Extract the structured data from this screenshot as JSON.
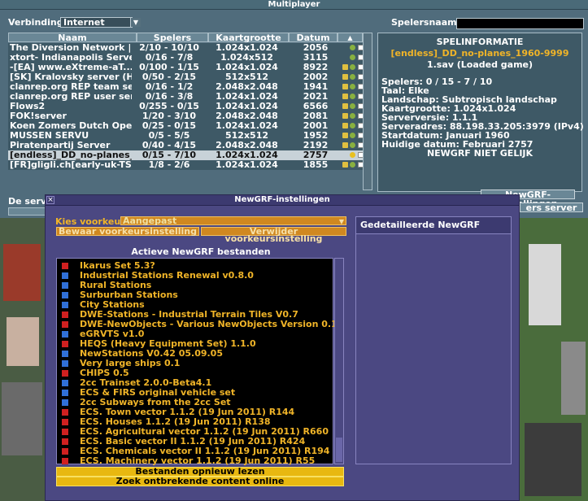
{
  "multiplayer": {
    "title": "Multiplayer",
    "connection_label": "Verbinding:",
    "connection_value": "Internet",
    "player_name_label": "Spelersnaam:",
    "columns": [
      "Naam",
      "Spelers",
      "Kaartgrootte",
      "Datum"
    ],
    "servers": [
      {
        "name": "The Diversion Network | O...",
        "players": "2/10 - 10/10",
        "map": "1.024x1.024",
        "date": "2056",
        "lock": false,
        "status": "green"
      },
      {
        "name": "xtort- Indianapolis Server ...",
        "players": "0/16 - 7/8",
        "map": "1.024x512",
        "date": "3115",
        "lock": false,
        "status": "green"
      },
      {
        "name": "-[EA] www.eXtreme-aT...",
        "players": "0/100 - 1/15",
        "map": "1.024x1.024",
        "date": "8922",
        "lock": true,
        "status": "green"
      },
      {
        "name": "[SK] Kralovsky server (Ha...",
        "players": "0/50 - 2/15",
        "map": "512x512",
        "date": "2002",
        "lock": true,
        "status": "green"
      },
      {
        "name": "clanrep.org REP team server",
        "players": "0/16 - 1/2",
        "map": "2.048x2.048",
        "date": "1941",
        "lock": true,
        "status": "green"
      },
      {
        "name": "clanrep.org REP user server",
        "players": "0/16 - 3/8",
        "map": "1.024x1.024",
        "date": "2021",
        "lock": true,
        "status": "green"
      },
      {
        "name": "Flows2",
        "players": "0/255 - 0/15",
        "map": "1.024x1.024",
        "date": "6566",
        "lock": true,
        "status": "green"
      },
      {
        "name": "FOK!server",
        "players": "1/20 - 3/10",
        "map": "2.048x2.048",
        "date": "2081",
        "lock": true,
        "status": "green"
      },
      {
        "name": "Koen Zomers Dutch OpenT...",
        "players": "0/25 - 0/15",
        "map": "1.024x1.024",
        "date": "2001",
        "lock": true,
        "status": "green"
      },
      {
        "name": "MUSSEN SERVU",
        "players": "0/5 - 5/5",
        "map": "512x512",
        "date": "1952",
        "lock": true,
        "status": "green"
      },
      {
        "name": "Piratenpartij Server",
        "players": "0/40 - 4/15",
        "map": "2.048x2.048",
        "date": "2192",
        "lock": true,
        "status": "green"
      },
      {
        "name": "[endless]_DD_no-planes_...",
        "players": "0/15 - 7/10",
        "map": "1.024x1.024",
        "date": "2757",
        "lock": false,
        "status": "yellow",
        "selected": true
      },
      {
        "name": "[FR]gligli.ch[early-uk-TS]...",
        "players": "1/8 - 2/6",
        "map": "1.024x1.024",
        "date": "1855",
        "lock": true,
        "status": "green"
      }
    ],
    "info": {
      "header": "SPELINFORMATIE",
      "server_name": "[endless]_DD_no-planes_1960-9999",
      "save_name": "1.sav (Loaded game)",
      "lines": [
        "Spelers: 0 / 15 - 7 / 10",
        "Taal: Elke",
        "Landschap: Subtropisch landschap",
        "Kaartgrootte: 1.024x1.024",
        "Serverversie: 1.1.1",
        "Serveradres: 88.198.33.205:3979 (IPv4)",
        "Startdatum: Januari 1960",
        "Huidige datum: Februari 2757"
      ],
      "newgrf_mismatch": "NEWGRF NIET GELIJK"
    },
    "newgrf_settings_button": "NewGRF-instellingen",
    "add_server_button": "ers server",
    "server_label": "De server"
  },
  "newgrf": {
    "title": "NewGRF-instellingen",
    "close_glyph": "×",
    "preset_label": "Kies voorkeur:",
    "preset_value": "Aangepast",
    "save_preset_button": "Bewaar voorkeursinstelling",
    "delete_preset_button": "Verwijder voorkeursinstelling",
    "active_header": "Actieve NewGRF bestanden",
    "files": [
      {
        "name": "Ikarus Set 5.3?",
        "icon": "red"
      },
      {
        "name": "Industrial Stations Renewal v0.8.0",
        "icon": "blue"
      },
      {
        "name": "Rural Stations",
        "icon": "blue"
      },
      {
        "name": "Surburban Stations",
        "icon": "blue"
      },
      {
        "name": "City Stations",
        "icon": "blue"
      },
      {
        "name": "DWE-Stations - Industrial Terrain Tiles V0.7",
        "icon": "red"
      },
      {
        "name": "DWE-NewObjects - Various NewObjects Version 0.1",
        "icon": "red"
      },
      {
        "name": "eGRVTS v1.0",
        "icon": "blue"
      },
      {
        "name": "HEQS (Heavy Equipment Set) 1.1.0",
        "icon": "red"
      },
      {
        "name": "NewStations V0.42 05.09.05",
        "icon": "blue"
      },
      {
        "name": "Very large ships 0.1",
        "icon": "blue"
      },
      {
        "name": "CHIPS 0.5",
        "icon": "red"
      },
      {
        "name": "2cc Trainset 2.0.0-Beta4.1",
        "icon": "blue"
      },
      {
        "name": "ECS & FIRS original vehicle set",
        "icon": "blue"
      },
      {
        "name": "2cc Subways from the 2cc Set",
        "icon": "blue"
      },
      {
        "name": "ECS. Town vector 1.1.2 (19 Jun 2011) R144",
        "icon": "red"
      },
      {
        "name": "ECS. Houses 1.1.2 (19 Jun 2011) R138",
        "icon": "red"
      },
      {
        "name": "ECS. Agricultural vector 1.1.2 (19 Jun 2011) R660",
        "icon": "red"
      },
      {
        "name": "ECS. Basic vector II 1.1.2 (19 Jun 2011) R424",
        "icon": "red"
      },
      {
        "name": "ECS. Chemicals vector II 1.1.2 (19 Jun 2011) R194",
        "icon": "red"
      },
      {
        "name": "ECS. Machinery vector 1.1.2 (19 Jun 2011) R55",
        "icon": "red"
      }
    ],
    "rescan_button": "Bestanden opnieuw lezen",
    "find_missing_button": "Zoek ontbrekende content online",
    "detail_header": "Gedetailleerde NewGRF informatie"
  }
}
